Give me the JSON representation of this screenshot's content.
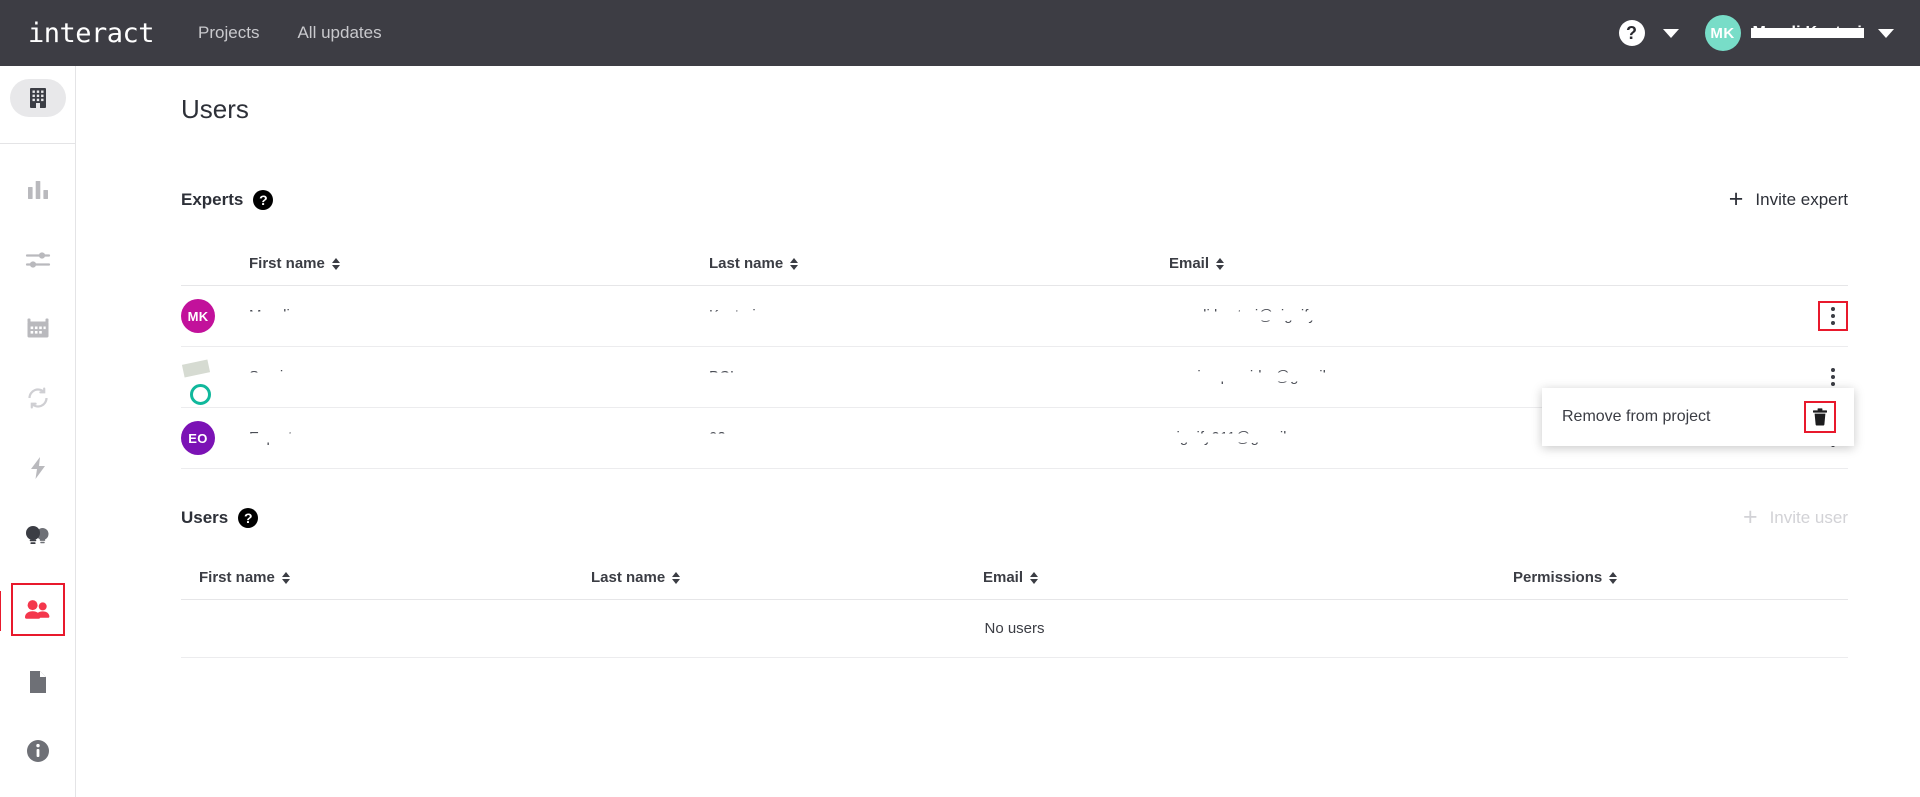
{
  "topbar": {
    "brand": "interact",
    "nav": [
      {
        "label": "Projects"
      },
      {
        "label": "All updates"
      }
    ],
    "help_icon": "question-mark-icon",
    "help_label": "?",
    "account": {
      "initials": "MK",
      "name": "Murali Kasturi",
      "avatar_color": "#78ddc8"
    }
  },
  "sidebar": {
    "items": [
      {
        "name": "building-icon",
        "label": "Organization",
        "active": false
      },
      {
        "name": "bar-chart-icon",
        "label": "Analytics",
        "active": false
      },
      {
        "name": "sliders-icon",
        "label": "Controls",
        "active": false
      },
      {
        "name": "calendar-icon",
        "label": "Schedule",
        "active": false
      },
      {
        "name": "sync-icon",
        "label": "Sync",
        "active": false
      },
      {
        "name": "lightning-icon",
        "label": "Energy",
        "active": false
      },
      {
        "name": "bulbs-icon",
        "label": "Lights",
        "active": false
      },
      {
        "name": "people-icon",
        "label": "Users",
        "active": true
      },
      {
        "name": "document-icon",
        "label": "Reports",
        "active": false
      },
      {
        "name": "info-icon",
        "label": "Info",
        "active": false
      }
    ]
  },
  "page": {
    "title": "Users"
  },
  "experts": {
    "title": "Experts",
    "help_label": "?",
    "invite_label": "Invite expert",
    "invite_plus": "+",
    "columns": [
      {
        "label": "First name"
      },
      {
        "label": "Last name"
      },
      {
        "label": "Email"
      }
    ],
    "rows": [
      {
        "initials": "MK",
        "avatar_color": "#c2119b",
        "avatar_type": "initials",
        "first_name": "Murali",
        "last_name": "Kasturi",
        "email": "murali.kasturi@signify.com",
        "redacted": true
      },
      {
        "initials": "",
        "avatar_color": "#0e9a86",
        "avatar_type": "photo",
        "first_name": "Service",
        "last_name": "BCI",
        "email": "service.provider@gmail.com",
        "redacted": true
      },
      {
        "initials": "EO",
        "avatar_color": "#7b12b5",
        "avatar_type": "initials",
        "first_name": "Expert",
        "last_name": "02",
        "email": "signify911@gmail.com",
        "redacted": true
      }
    ]
  },
  "row_menu": {
    "item_label": "Remove from project",
    "trash_icon": "trash-icon",
    "highlight_color": "#e8192c"
  },
  "users": {
    "title": "Users",
    "help_label": "?",
    "invite_label": "Invite user",
    "invite_plus": "+",
    "invite_disabled": true,
    "columns": [
      {
        "label": "First name"
      },
      {
        "label": "Last name"
      },
      {
        "label": "Email"
      },
      {
        "label": "Permissions"
      }
    ],
    "empty_text": "No users"
  }
}
